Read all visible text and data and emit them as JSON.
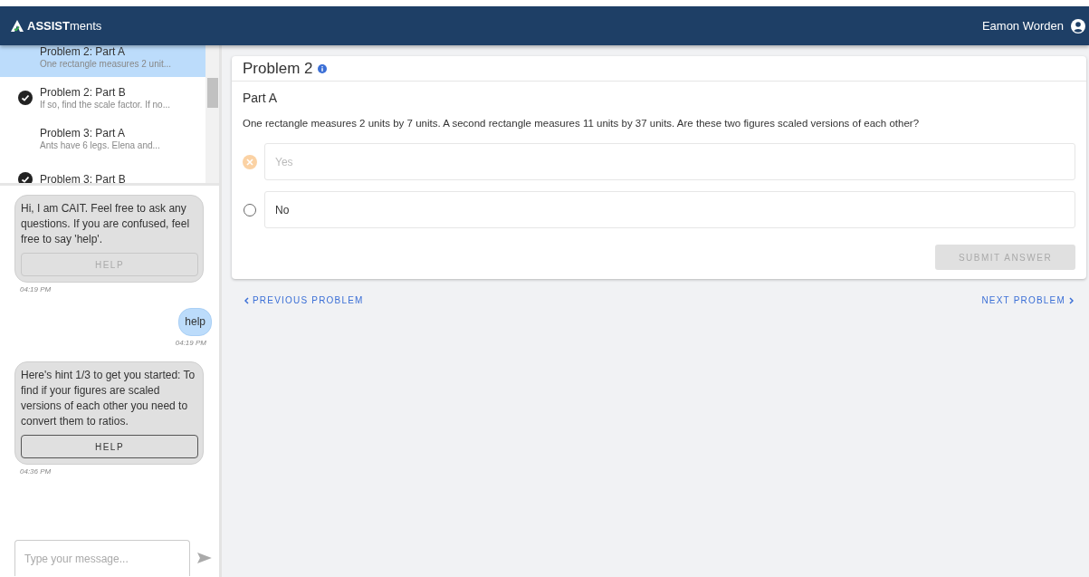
{
  "header": {
    "brand_bold": "ASSIST",
    "brand_light": "ments",
    "user": "Eamon Worden"
  },
  "problem_list": [
    {
      "title": "Problem 2: Part A",
      "snippet": "One rectangle measures 2 unit...",
      "selected": true,
      "completed": false
    },
    {
      "title": "Problem 2: Part B",
      "snippet": "If so, find the scale factor. If no...",
      "selected": false,
      "completed": true
    },
    {
      "title": "Problem 3: Part A",
      "snippet": "Ants have 6 legs. Elena and...",
      "selected": false,
      "completed": false
    },
    {
      "title": "Problem 3: Part B",
      "selected": false,
      "completed": true
    }
  ],
  "chat": {
    "messages": [
      {
        "kind": "bot",
        "text": "Hi, I am CAIT. Feel free to ask any questions. If you are confused, feel free to say 'help'.",
        "button": {
          "label": "HELP",
          "disabled": true
        },
        "time": "04:19 PM"
      },
      {
        "kind": "user",
        "text": "help",
        "time": "04:19 PM"
      },
      {
        "kind": "bot",
        "text": "Here's hint 1/3 to get you started: To find if your figures are scaled versions of each other you need to convert them to ratios.",
        "button": {
          "label": "HELP",
          "disabled": false
        },
        "time": "04:36 PM"
      }
    ],
    "input": {
      "placeholder": "Type your message..."
    }
  },
  "problem": {
    "title": "Problem 2",
    "part": "Part A",
    "question": "One rectangle measures 2 units by 7 units. A second rectangle measures 11 units by 37 units. Are these two figures scaled versions of each other?",
    "choices": [
      {
        "label": "Yes",
        "selected": false,
        "wrong": true
      },
      {
        "label": "No",
        "selected": false,
        "wrong": false
      }
    ],
    "submit": {
      "label": "SUBMIT ANSWER",
      "disabled": true
    }
  },
  "nav": {
    "previous": "PREVIOUS PROBLEM",
    "next": "NEXT PROBLEM"
  }
}
